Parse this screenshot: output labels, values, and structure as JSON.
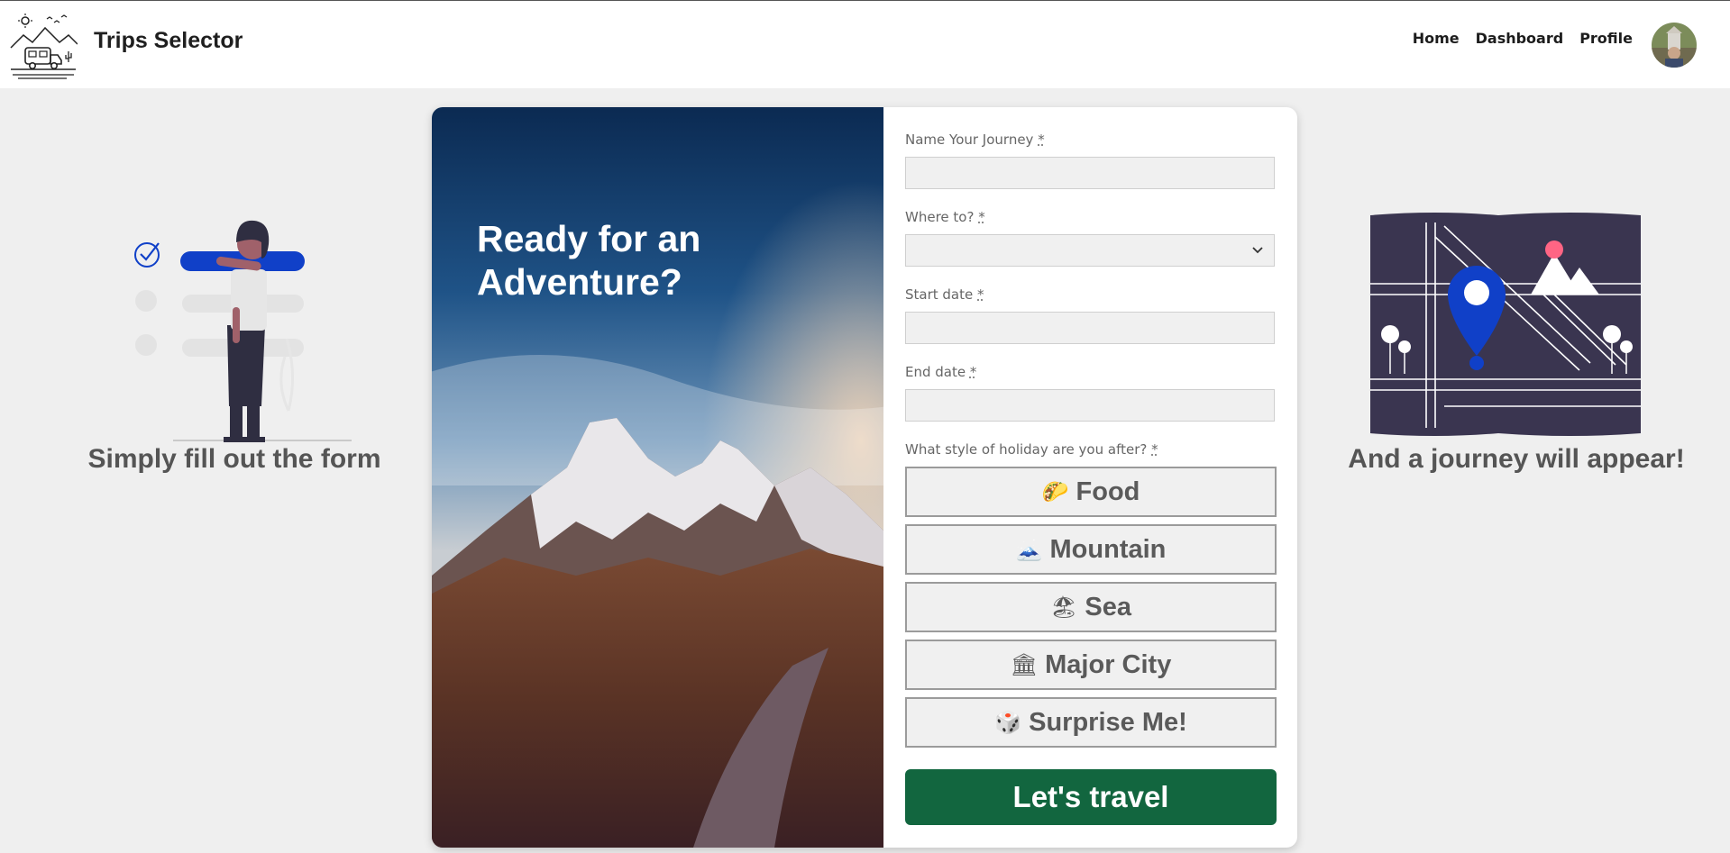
{
  "app": {
    "title": "Trips Selector"
  },
  "nav": {
    "links": [
      "Home",
      "Dashboard",
      "Profile"
    ]
  },
  "left": {
    "caption": "Simply fill out the form"
  },
  "right": {
    "caption": "And a journey will appear!"
  },
  "hero": {
    "title": "Ready for an Adventure?"
  },
  "form": {
    "required_marker": "*",
    "name": {
      "label": "Name Your Journey",
      "value": ""
    },
    "where": {
      "label": "Where to?",
      "value": ""
    },
    "start": {
      "label": "Start date",
      "value": ""
    },
    "end": {
      "label": "End date",
      "value": ""
    },
    "style_label": "What style of holiday are you after?",
    "styles": [
      {
        "emoji": "🌮",
        "label": "Food"
      },
      {
        "emoji": "🗻",
        "label": "Mountain"
      },
      {
        "emoji": "🏖",
        "label": "Sea"
      },
      {
        "emoji": "🏛",
        "label": "Major City"
      },
      {
        "emoji": "🎲",
        "label": "Surprise Me!"
      }
    ],
    "submit_label": "Let's travel"
  },
  "colors": {
    "submit": "#12663f",
    "pin": "#1040c8",
    "map_bg": "#3a3550"
  }
}
